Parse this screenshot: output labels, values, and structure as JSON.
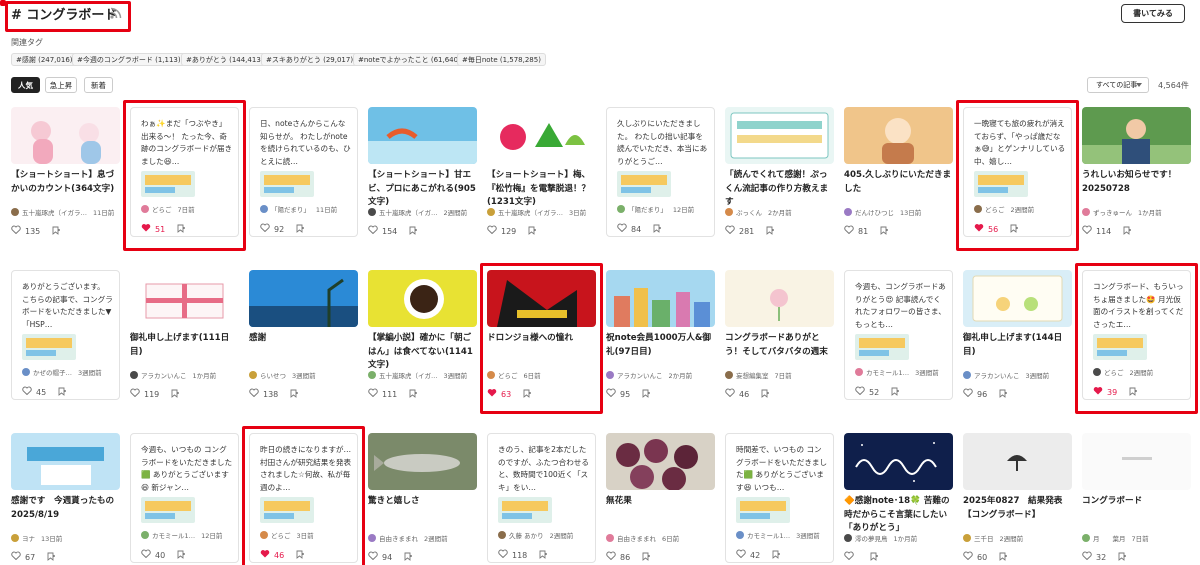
{
  "page": {
    "title": "# コングラボード",
    "write_button": "書いてみる",
    "related_label": "関連タグ",
    "count": "4,564件",
    "sort_select": "すべての記事"
  },
  "tags": [
    "#感謝 (247,016)",
    "#今週のコングラボード (1,113)",
    "#ありがとう (144,413)",
    "#スキありがとう (29,017)",
    "#noteでよかったこと (61,640)",
    "#毎日note (1,578,285)"
  ],
  "sort_tabs": [
    "人気",
    "急上昇",
    "新着"
  ],
  "icons": {
    "rss": "rss-icon",
    "heart": "heart-icon",
    "bookmark": "bookmark-icon",
    "caret": "chevron-down-icon"
  },
  "colors": {
    "highlight": "#e60012",
    "liked": "#e5194b"
  },
  "cards": [
    {
      "title": "【ショートショート】息づかいのカウント(364文字)",
      "author": "五十嵐琢虎（イガラ…",
      "time": "11日前",
      "likes": "135",
      "thumb": "pink"
    },
    {
      "quote": "わぁ✨まだ「つぶやき」出来る〜！ たった今、奇跡のコングラボードが届きました😆…",
      "author": "どらご",
      "time": "7日前",
      "likes": "51",
      "liked": true
    },
    {
      "quote": "日、noteさんからこんな知らせが。 わたしがnoteを続けられているのも、ひとえに読…",
      "author": "「陽だまり」",
      "time": "11日前",
      "likes": "92"
    },
    {
      "title": "【ショートショート】甘エビ、プロにあこがれる(905文字)",
      "author": "五十嵐琢虎（イガ…",
      "time": "2週間前",
      "likes": "154",
      "thumb": "sea"
    },
    {
      "title": "【ショートショート】梅、『松竹梅』を電撃脱退！？(1231文字)",
      "author": "五十嵐琢虎（イガラ…",
      "time": "3日前",
      "likes": "129",
      "thumb": "ume"
    },
    {
      "quote": "久しぶりにいただきました。 わたしの拙い記事を読んでいただき、本当にありがとうご…",
      "author": "「陽だまり」",
      "time": "12日前",
      "likes": "84"
    },
    {
      "title": "「読んでくれて感謝！ぷっくん流記事の作り方教えます",
      "author": "ぷっくん",
      "time": "2か月前",
      "likes": "281",
      "thumb": "teal"
    },
    {
      "title": "405.久しぶりにいただきました",
      "author": "だんけひつじ",
      "time": "13日前",
      "likes": "81",
      "thumb": "warm"
    },
    {
      "quote": "一晩寝ても旅の疲れが消えておらず、「やっぱ歳だなぁ😅」とゲンナリしている中、嬉し…",
      "author": "どらご",
      "time": "2週間前",
      "likes": "56",
      "liked": true
    },
    {
      "title": "うれしいお知らせです！20250728",
      "author": "ずっきゅーん",
      "time": "1か月前",
      "likes": "114",
      "thumb": "green"
    },
    {
      "quote": "ありがとうございます。 こちらの記事で、コングラボードをいただきました▼ 「HSP…",
      "author": "かぜの帽子…",
      "time": "3週間前",
      "likes": "45"
    },
    {
      "title": "御礼申し上げます(111日目)",
      "author": "アラカンいんこ",
      "time": "1か月前",
      "likes": "119",
      "thumb": "gift"
    },
    {
      "title": "感謝",
      "author": "らいせつ",
      "time": "3週間前",
      "likes": "138",
      "thumb": "blue"
    },
    {
      "title": "【掌編小説】確かに「朝ごはん」は食べてない(1141文字)",
      "author": "五十嵐琢虎（イガ…",
      "time": "3週間前",
      "likes": "111",
      "thumb": "coffee"
    },
    {
      "title": "ドロンジョ様への憧れ",
      "author": "どらご",
      "time": "6日前",
      "likes": "63",
      "thumb": "red",
      "liked": true
    },
    {
      "title": "祝note会員1000万人&御礼(97日目)",
      "author": "アラカンいんこ",
      "time": "2か月前",
      "likes": "95",
      "thumb": "city"
    },
    {
      "title": "コングラボードありがとう！そしてバタバタの週末",
      "author": "妄想編集室",
      "time": "7日前",
      "likes": "46",
      "thumb": "cream"
    },
    {
      "quote": "今週も、コングラボードありがとう😍 記事読んでくれたフォロワーの皆さま、もっとも…",
      "author": "カモミール1…",
      "time": "3週間前",
      "likes": "52"
    },
    {
      "title": "御礼申し上げます(144日目)",
      "author": "アラカンいんこ",
      "time": "3週間前",
      "likes": "96",
      "thumb": "card"
    },
    {
      "quote": "コングラボード、もういっちょ届きました🤩 月光仮面のイラストを創ってくださったエ…",
      "author": "どらご",
      "time": "2週間前",
      "likes": "39",
      "liked": true
    },
    {
      "title": "感謝です　今週貰ったもの　2025/8/19",
      "author": "ヨナ",
      "time": "13日前",
      "likes": "67",
      "thumb": "congrats"
    },
    {
      "quote": "今週も、いつもの コングラボードをいただきました🟩 ありがとうございます😆 新ジャン…",
      "author": "カモミール1…",
      "time": "12日前",
      "likes": "40"
    },
    {
      "quote": "昨日の続きになりますが…村田さんが研究結果を発表されました☆何故、私が毎週のよ…",
      "author": "どらご",
      "time": "3日前",
      "likes": "46",
      "liked": true
    },
    {
      "title": "驚きと嬉しさ",
      "author": "自由きままれ",
      "time": "2週間前",
      "likes": "94",
      "thumb": "fish"
    },
    {
      "quote": "きのう、記事を2本だしたのですが、ふたつ合わせると、数時間で100近く「スキ」をい…",
      "author": "久藤 あかり",
      "time": "2週間前",
      "likes": "118"
    },
    {
      "title": "無花果",
      "author": "自由きままれ",
      "time": "6日前",
      "likes": "86",
      "thumb": "figs"
    },
    {
      "quote": "時間差で、いつもの コングラボードをいただきました🟩 ありがとうございます😆 いつも…",
      "author": "カモミール1…",
      "time": "3週間前",
      "likes": "42"
    },
    {
      "title": "🔶感謝note･18🍀 苦難の時だからこそ言葉にしたい「ありがとう」",
      "author": "澪の夢見鳥",
      "time": "1か月前",
      "likes": "",
      "thumb": "navy"
    },
    {
      "title": "2025年0827　結果発表　【コングラボード】",
      "author": "三千日",
      "time": "2週間前",
      "likes": "60",
      "thumb": "gray"
    },
    {
      "title": "コングラボード",
      "author": "月　　葉月",
      "time": "7日前",
      "likes": "32",
      "thumb": "note"
    }
  ]
}
